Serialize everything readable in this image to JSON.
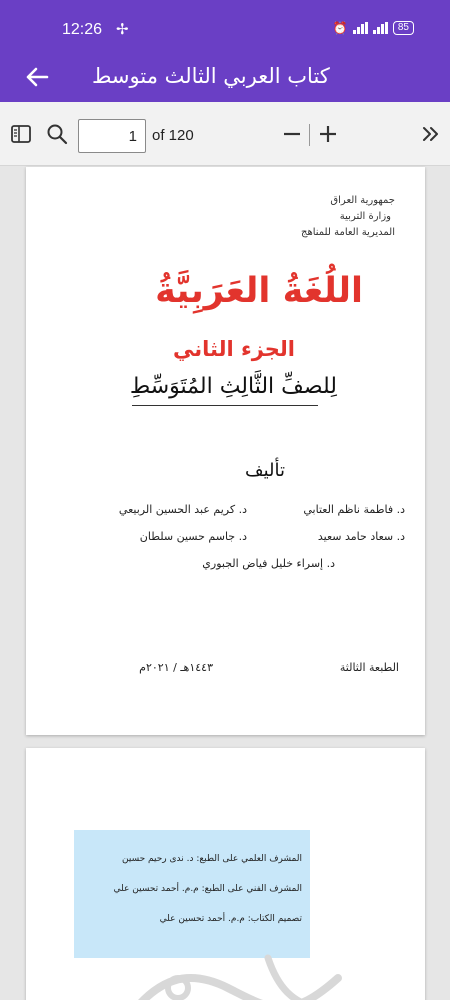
{
  "status_bar": {
    "time": "12:26",
    "battery": "85"
  },
  "app_bar": {
    "title": "كتاب العربي الثالث متوسط"
  },
  "toolbar": {
    "page_value": "1",
    "page_of": "of 120"
  },
  "page1": {
    "header": [
      "جمهورية العراق",
      "وزارة التربية",
      "المديرية العامة للمناهج"
    ],
    "subject": "اللُغَةُ العَرَبِيَّةُ",
    "part": "الجزء الثاني",
    "grade": "لِلصفِّ الثَّالِثِ المُتَوَسِّطِ",
    "authors_heading": "تأليف",
    "authors": [
      "د. فاطمة ناظم العتابي",
      "د. كريم عبد الحسين الربيعي",
      "د. سعاد حامد سعيد",
      "د. جاسم حسين سلطان",
      "د. إسراء خليل فياض الجبوري"
    ],
    "edition": "الطبعة الثالثة",
    "year": "١٤٤٣هـ / ٢٠٢١م"
  },
  "page2": {
    "lines": [
      "المشرف العلمي على الطبع: د. ندى رحيم حسين",
      "المشرف الفني على الطبع: م.م. أحمد تحسين علي",
      "تصميم الكتاب: م.م. أحمد تحسين علي"
    ]
  },
  "colors": {
    "primary": "#6a3fc5",
    "title_red": "#e2342d",
    "info_box": "#c8e7f9"
  }
}
